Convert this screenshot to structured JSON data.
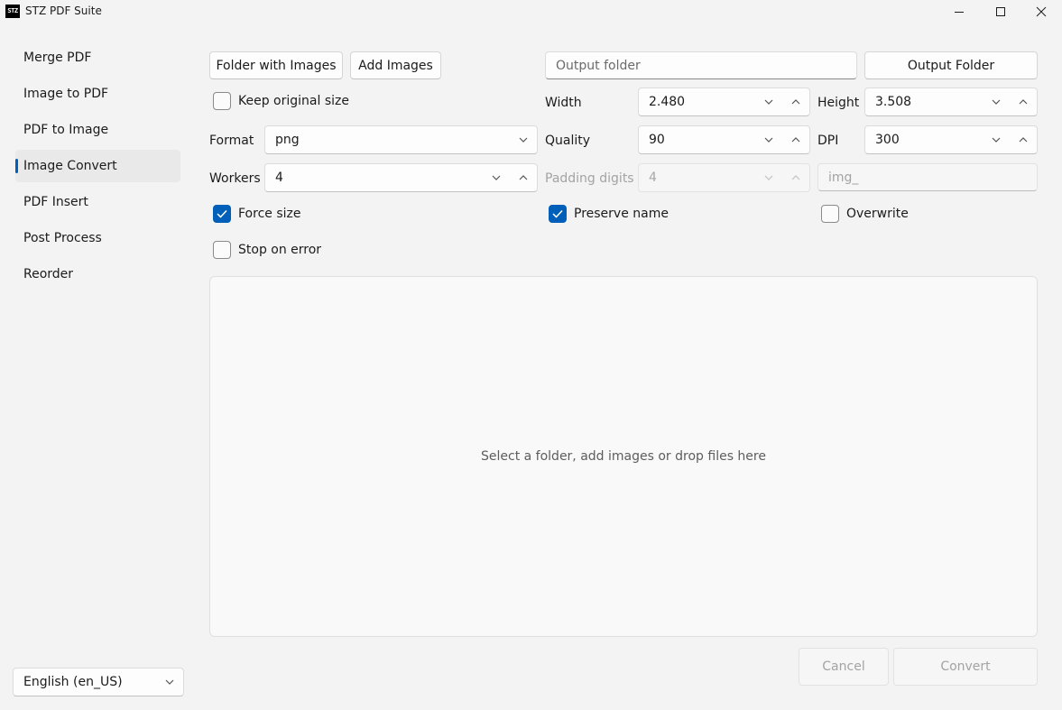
{
  "window": {
    "logo_text": "STZ",
    "title": "STZ PDF Suite"
  },
  "sidebar": {
    "items": [
      {
        "label": "Merge PDF"
      },
      {
        "label": "Image to PDF"
      },
      {
        "label": "PDF to Image"
      },
      {
        "label": "Image Convert",
        "active": true
      },
      {
        "label": "PDF Insert"
      },
      {
        "label": "Post Process"
      },
      {
        "label": "Reorder"
      }
    ],
    "language": "English (en_US)"
  },
  "toolbar": {
    "folder_with_images_label": "Folder with Images",
    "add_images_label": "Add Images",
    "output_folder_placeholder": "Output folder",
    "output_folder_button_label": "Output Folder"
  },
  "options": {
    "keep_original_size": {
      "label": "Keep original size",
      "checked": false
    },
    "width": {
      "label": "Width",
      "value": "2.480"
    },
    "height": {
      "label": "Height",
      "value": "3.508"
    },
    "format": {
      "label": "Format",
      "value": "png"
    },
    "quality": {
      "label": "Quality",
      "value": "90"
    },
    "dpi": {
      "label": "DPI",
      "value": "300"
    },
    "workers": {
      "label": "Workers",
      "value": "4"
    },
    "padding_digits": {
      "label": "Padding digits",
      "value": "4",
      "disabled": true
    },
    "prefix": {
      "placeholder": "img_",
      "disabled": true
    },
    "force_size": {
      "label": "Force size",
      "checked": true
    },
    "preserve_name": {
      "label": "Preserve name",
      "checked": true
    },
    "overwrite": {
      "label": "Overwrite",
      "checked": false
    },
    "stop_on_error": {
      "label": "Stop on error",
      "checked": false
    }
  },
  "dropzone": {
    "text": "Select a folder, add images or drop files here"
  },
  "actions": {
    "cancel_label": "Cancel",
    "convert_label": "Convert"
  },
  "colors": {
    "accent": "#005fb8",
    "background": "#f3f3f3"
  }
}
